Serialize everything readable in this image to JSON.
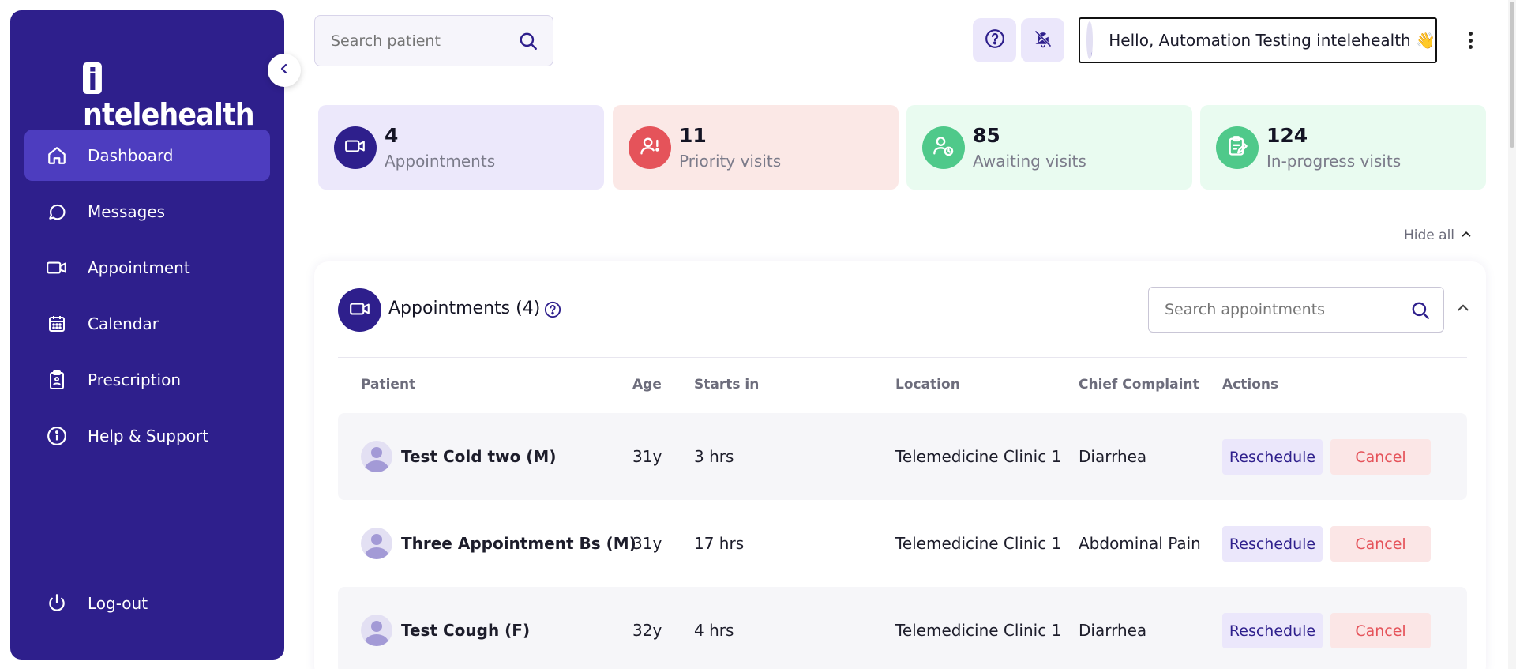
{
  "brand": {
    "logo_text": "ntelehealth",
    "logo_letter": "i"
  },
  "sidebar": {
    "items": [
      {
        "label": "Dashboard",
        "icon": "home-icon",
        "active": true
      },
      {
        "label": "Messages",
        "icon": "message-icon",
        "active": false
      },
      {
        "label": "Appointment",
        "icon": "video-icon",
        "active": false
      },
      {
        "label": "Calendar",
        "icon": "calendar-icon",
        "active": false
      },
      {
        "label": "Prescription",
        "icon": "clipboard-icon",
        "active": false
      },
      {
        "label": "Help & Support",
        "icon": "info-icon",
        "active": false
      }
    ],
    "logout_label": "Log-out"
  },
  "header": {
    "search_placeholder": "Search patient",
    "greeting": "Hello, Automation Testing intelehealth 👋"
  },
  "stats": [
    {
      "value": "4",
      "label": "Appointments",
      "bg": "#ece8fb",
      "icon_bg": "#2e1f8c",
      "icon": "video-icon"
    },
    {
      "value": "11",
      "label": "Priority visits",
      "bg": "#fbe8e6",
      "icon_bg": "#e5535a",
      "icon": "priority-user-icon"
    },
    {
      "value": "85",
      "label": "Awaiting visits",
      "bg": "#e9fbf0",
      "icon_bg": "#4fc98a",
      "icon": "user-clock-icon"
    },
    {
      "value": "124",
      "label": "In-progress visits",
      "bg": "#e9fbf0",
      "icon_bg": "#4fc98a",
      "icon": "edit-note-icon"
    }
  ],
  "hide_all_label": "Hide all",
  "appointments": {
    "title": "Appointments (4)",
    "search_placeholder": "Search appointments",
    "columns": [
      "Patient",
      "Age",
      "Starts in",
      "Location",
      "Chief Complaint",
      "Actions"
    ],
    "rows": [
      {
        "patient": "Test Cold two (M)",
        "age": "31y",
        "starts_in": "3 hrs",
        "location": "Telemedicine Clinic 1",
        "complaint": "Diarrhea",
        "reschedule": "Reschedule",
        "cancel": "Cancel"
      },
      {
        "patient": "Three Appointment Bs (M)",
        "age": "31y",
        "starts_in": "17 hrs",
        "location": "Telemedicine Clinic 1",
        "complaint": "Abdominal Pain",
        "reschedule": "Reschedule",
        "cancel": "Cancel"
      },
      {
        "patient": "Test Cough (F)",
        "age": "32y",
        "starts_in": "4 hrs",
        "location": "Telemedicine Clinic 1",
        "complaint": "Diarrhea",
        "reschedule": "Reschedule",
        "cancel": "Cancel"
      }
    ]
  },
  "colors": {
    "primary": "#2e1f8c",
    "primary_light": "#ebe7fb",
    "danger": "#e5535a",
    "success": "#4fc98a"
  }
}
